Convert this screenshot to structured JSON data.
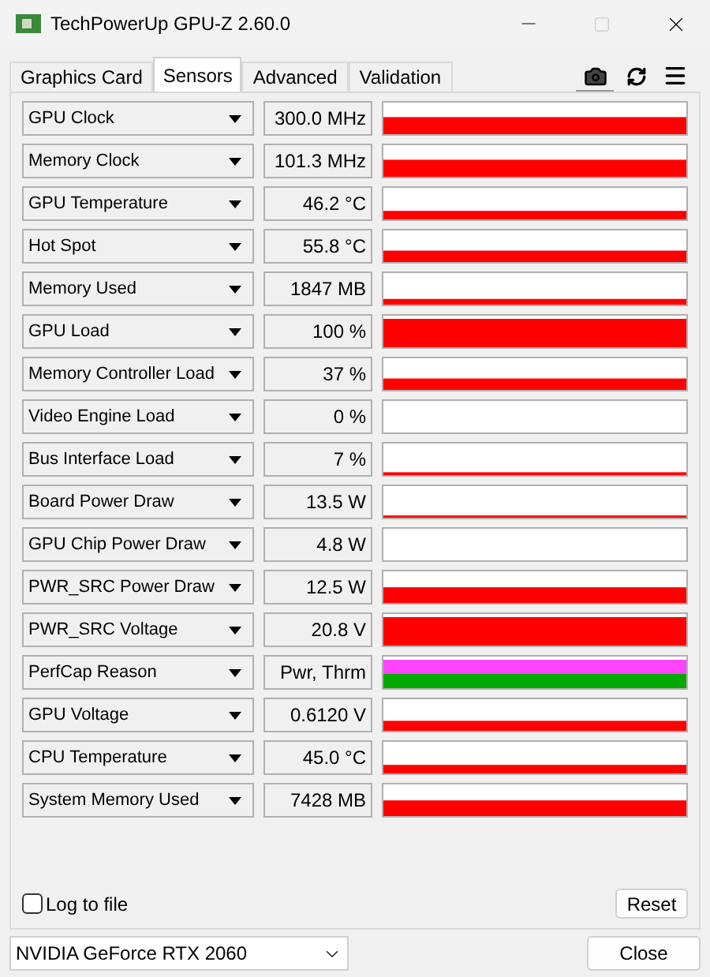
{
  "window": {
    "title": "TechPowerUp GPU-Z 2.60.0"
  },
  "tabs": [
    {
      "label": "Graphics Card",
      "selected": false
    },
    {
      "label": "Sensors",
      "selected": true
    },
    {
      "label": "Advanced",
      "selected": false
    },
    {
      "label": "Validation",
      "selected": false
    }
  ],
  "sensors": [
    {
      "name": "GPU Clock",
      "reading": "300.0 MHz",
      "kind": "line"
    },
    {
      "name": "Memory Clock",
      "reading": "101.3 MHz",
      "kind": "line"
    },
    {
      "name": "GPU Temperature",
      "reading": "46.2 °C",
      "kind": "line"
    },
    {
      "name": "Hot Spot",
      "reading": "55.8 °C",
      "kind": "line"
    },
    {
      "name": "Memory Used",
      "reading": "1847 MB",
      "kind": "line"
    },
    {
      "name": "GPU Load",
      "reading": "100 %",
      "kind": "line"
    },
    {
      "name": "Memory Controller Load",
      "reading": "37 %",
      "kind": "line"
    },
    {
      "name": "Video Engine Load",
      "reading": "0 %",
      "kind": "line"
    },
    {
      "name": "Bus Interface Load",
      "reading": "7 %",
      "kind": "line"
    },
    {
      "name": "Board Power Draw",
      "reading": "13.5 W",
      "kind": "line"
    },
    {
      "name": "GPU Chip Power Draw",
      "reading": "4.8 W",
      "kind": "line"
    },
    {
      "name": "PWR_SRC Power Draw",
      "reading": "12.5 W",
      "kind": "line"
    },
    {
      "name": "PWR_SRC Voltage",
      "reading": "20.8 V",
      "kind": "line"
    },
    {
      "name": "PerfCap Reason",
      "reading": "Pwr, Thrm",
      "kind": "perfcap"
    },
    {
      "name": "GPU Voltage",
      "reading": "0.6120 V",
      "kind": "line"
    },
    {
      "name": "CPU Temperature",
      "reading": "45.0 °C",
      "kind": "line"
    },
    {
      "name": "System Memory Used",
      "reading": "7428 MB",
      "kind": "line"
    }
  ],
  "log_to_file": {
    "label": "Log to file",
    "checked": false
  },
  "reset_button": "Reset",
  "gpu_select": {
    "value": "NVIDIA GeForce RTX 2060"
  },
  "close_button": "Close"
}
